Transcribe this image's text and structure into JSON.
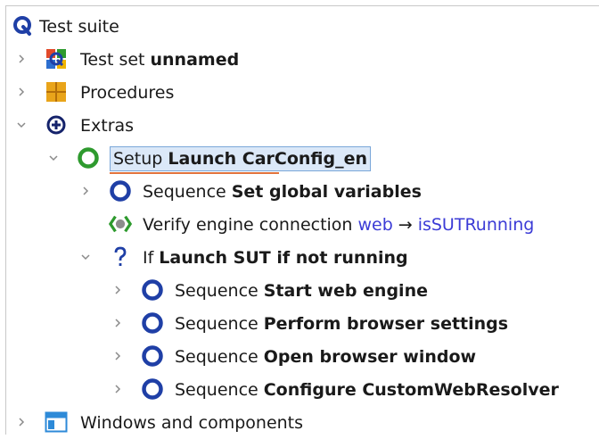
{
  "colors": {
    "accent": "#1f3fa6",
    "green": "#2e9a2e",
    "selection": "#dbe8f8",
    "link": "#3b3bd6"
  },
  "tree": {
    "root": {
      "icon": "qf-test-logo-icon",
      "label": "Test suite"
    },
    "test_set": {
      "icon": "test-set-icon",
      "prefix": "Test set",
      "name": "unnamed"
    },
    "procedures": {
      "icon": "procedures-icon",
      "label": "Procedures"
    },
    "extras": {
      "icon": "extras-plus-icon",
      "label": "Extras"
    },
    "setup": {
      "icon": "setup-circle-icon",
      "prefix": "Setup",
      "name": "Launch CarConfig_en"
    },
    "seq_globals": {
      "icon": "sequence-circle-icon",
      "prefix": "Sequence",
      "name": "Set global variables"
    },
    "verify": {
      "icon": "check-engine-icon",
      "prefix": "Verify engine connection",
      "engine": "web",
      "arrow": "→",
      "variable": "isSUTRunning"
    },
    "if_node": {
      "icon": "question-icon",
      "prefix": "If",
      "name": "Launch SUT if not running"
    },
    "seq_start": {
      "icon": "sequence-circle-icon",
      "prefix": "Sequence",
      "name": "Start web engine"
    },
    "seq_browser_settings": {
      "icon": "sequence-circle-icon",
      "prefix": "Sequence",
      "name": "Perform browser settings"
    },
    "seq_open_window": {
      "icon": "sequence-circle-icon",
      "prefix": "Sequence",
      "name": "Open browser window"
    },
    "seq_resolver": {
      "icon": "sequence-circle-icon",
      "prefix": "Sequence",
      "name": "Configure CustomWebResolver"
    },
    "windows": {
      "icon": "windows-components-icon",
      "label": "Windows and components"
    }
  }
}
